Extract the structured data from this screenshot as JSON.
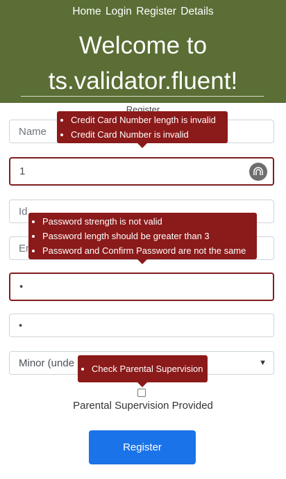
{
  "nav": {
    "home": "Home",
    "login": "Login",
    "register": "Register",
    "details": "Details"
  },
  "title_line1": "Welcome to",
  "title_line2": "ts.validator.fluent!",
  "register_heading": "Register",
  "fields": {
    "name_placeholder": "Name",
    "credit_card_value": "1",
    "id_placeholder": "Id",
    "email_placeholder": "Em",
    "password_value": "•",
    "confirm_password_value": "•",
    "age_select_value": "Minor (unde"
  },
  "errors": {
    "credit_card": [
      "Credit Card Number length is invalid",
      "Credit Card Number is invalid"
    ],
    "password": [
      "Password strength is not valid",
      "Password length should be greater than 3",
      "Password and Confirm Password are not the same"
    ],
    "parental": [
      "Check Parental Supervision"
    ]
  },
  "checkbox_label": "Parental Supervision Provided",
  "submit_label": "Register",
  "colors": {
    "header": "#5a6e35",
    "error": "#8b1a1a",
    "button": "#1a73e8"
  }
}
